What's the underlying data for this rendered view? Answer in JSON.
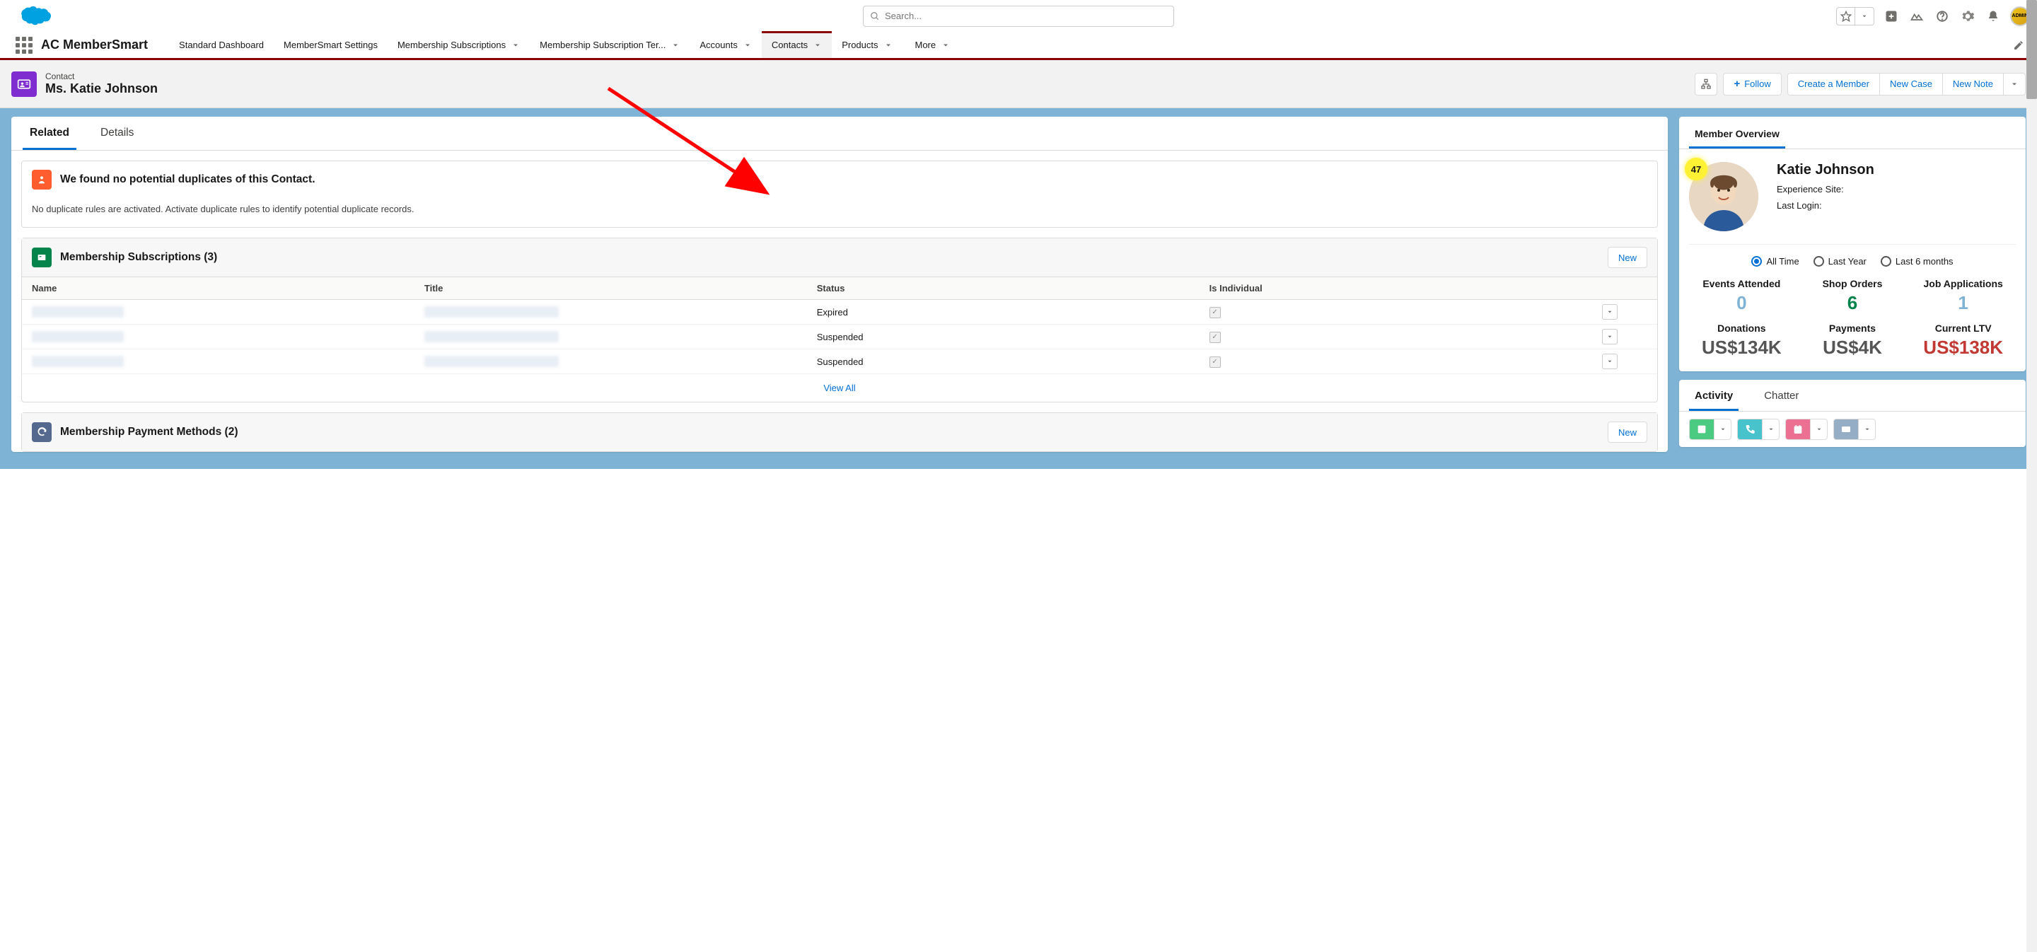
{
  "search": {
    "placeholder": "Search..."
  },
  "adminBadge": "ADMIN",
  "appName": "AC MemberSmart",
  "nav": {
    "items": {
      "0": "Standard Dashboard",
      "1": "MemberSmart Settings",
      "2": "Membership Subscriptions",
      "3": "Membership Subscription Ter...",
      "4": "Accounts",
      "5": "Contacts",
      "6": "Products",
      "more": "More"
    }
  },
  "record": {
    "type": "Contact",
    "title": "Ms. Katie Johnson"
  },
  "actions": {
    "follow": "Follow",
    "createMember": "Create a Member",
    "newCase": "New Case",
    "newNote": "New Note"
  },
  "mainTabs": {
    "related": "Related",
    "details": "Details"
  },
  "dup": {
    "title": "We found no potential duplicates of this Contact.",
    "body": "No duplicate rules are activated. Activate duplicate rules to identify potential duplicate records."
  },
  "subs": {
    "title": "Membership Subscriptions (3)",
    "newBtn": "New",
    "cols": {
      "name": "Name",
      "title": "Title",
      "status": "Status",
      "individual": "Is Individual"
    },
    "rows": {
      "0": {
        "status": "Expired"
      },
      "1": {
        "status": "Suspended"
      },
      "2": {
        "status": "Suspended"
      }
    },
    "viewAll": "View All"
  },
  "payMethods": {
    "title": "Membership Payment Methods (2)",
    "newBtn": "New"
  },
  "overview": {
    "tab": "Member Overview",
    "badge": "47",
    "name": "Katie Johnson",
    "expSite": "Experience Site:",
    "lastLogin": "Last Login:",
    "filters": {
      "all": "All Time",
      "year": "Last Year",
      "six": "Last 6 months"
    },
    "stats": {
      "events": {
        "lbl": "Events Attended",
        "val": "0"
      },
      "orders": {
        "lbl": "Shop Orders",
        "val": "6"
      },
      "jobs": {
        "lbl": "Job Applications",
        "val": "1"
      },
      "donations": {
        "lbl": "Donations",
        "val": "US$134K"
      },
      "payments": {
        "lbl": "Payments",
        "val": "US$4K"
      },
      "ltv": {
        "lbl": "Current LTV",
        "val": "US$138K"
      }
    }
  },
  "activity": {
    "tab1": "Activity",
    "tab2": "Chatter"
  }
}
